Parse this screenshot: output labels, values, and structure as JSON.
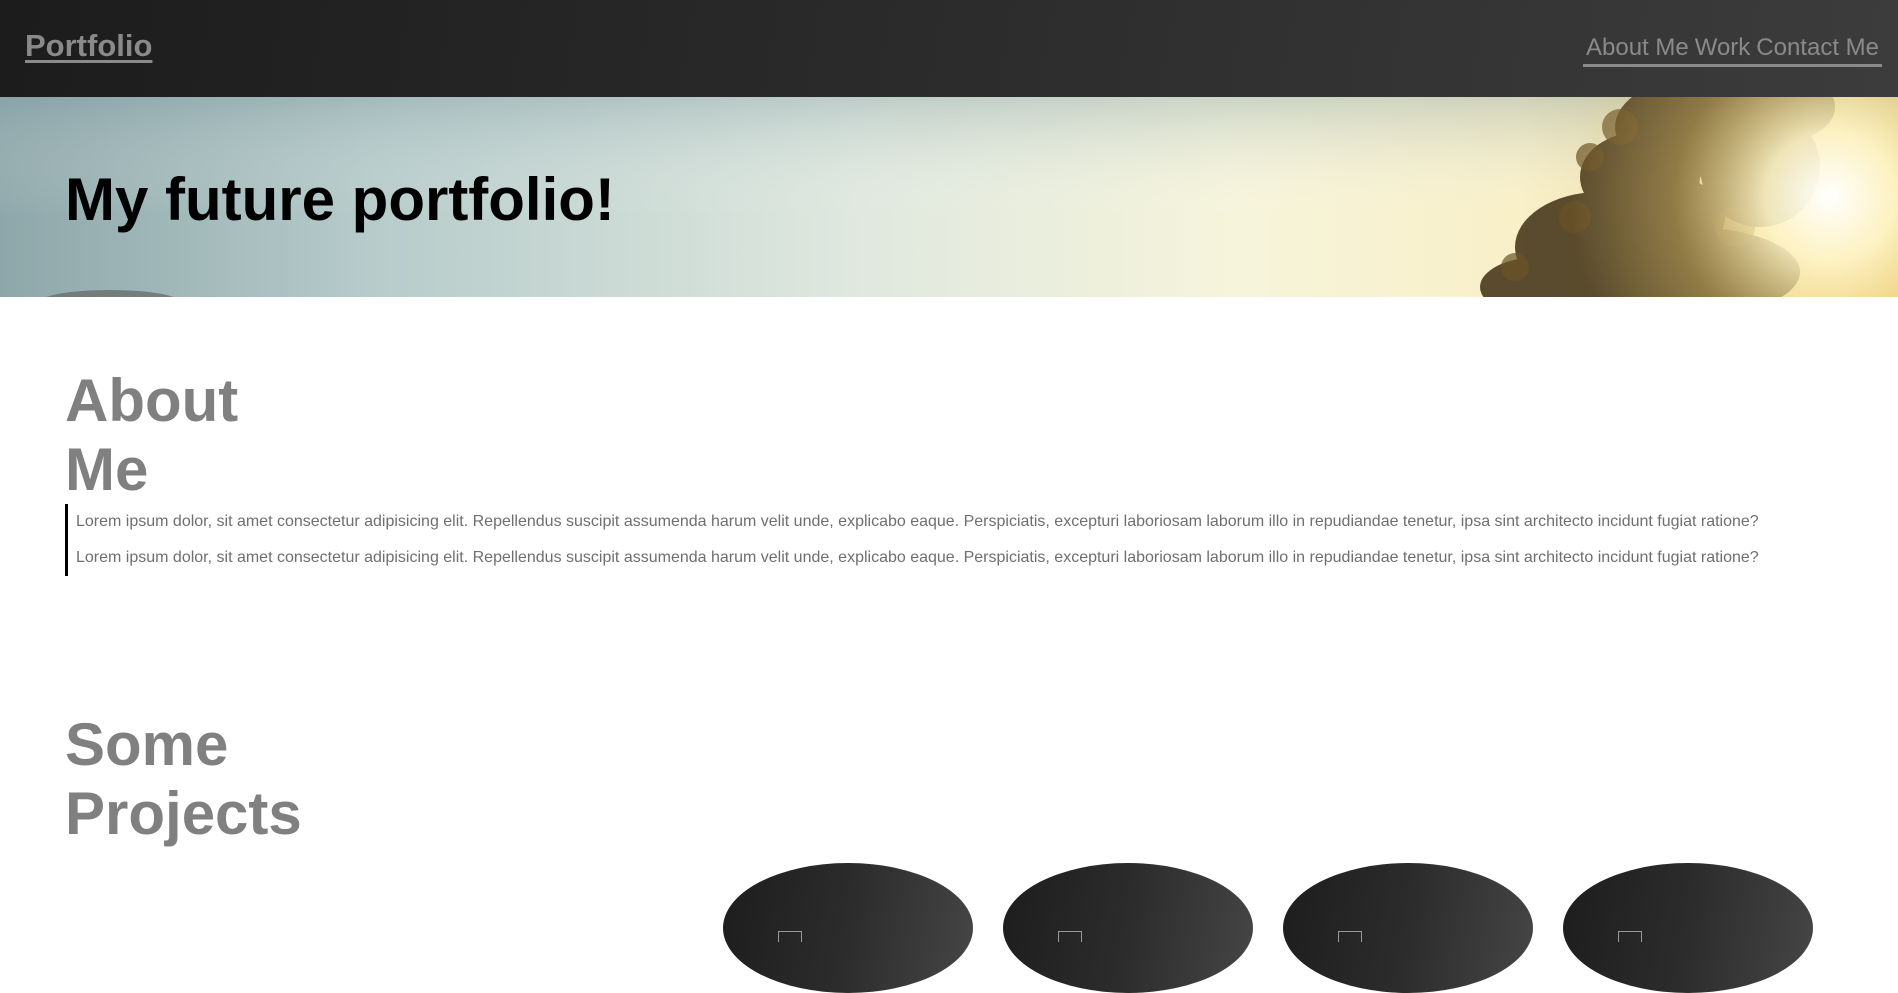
{
  "navbar": {
    "brand": "Portfolio",
    "links": [
      "About Me",
      "Work",
      "Contact Me"
    ]
  },
  "hero": {
    "title": "My future portfolio!"
  },
  "about": {
    "heading_line1": "About",
    "heading_line2": "Me",
    "paragraphs": [
      "Lorem ipsum dolor, sit amet consectetur adipisicing elit. Repellendus suscipit assumenda harum velit unde, explicabo eaque. Perspiciatis, excepturi laboriosam laborum illo in repudiandae tenetur, ipsa sint architecto incidunt fugiat ratione?",
      "Lorem ipsum dolor, sit amet consectetur adipisicing elit. Repellendus suscipit assumenda harum velit unde, explicabo eaque. Perspiciatis, excepturi laboriosam laborum illo in repudiandae tenetur, ipsa sint architecto incidunt fugiat ratione?"
    ]
  },
  "projects": {
    "heading_line1": "Some",
    "heading_line2": "Projects",
    "card_count": 4
  },
  "colors": {
    "navbar": "#2a2a2a",
    "link": "#8a8a8a",
    "heading": "#808080",
    "body_text": "#6f6f6f"
  }
}
